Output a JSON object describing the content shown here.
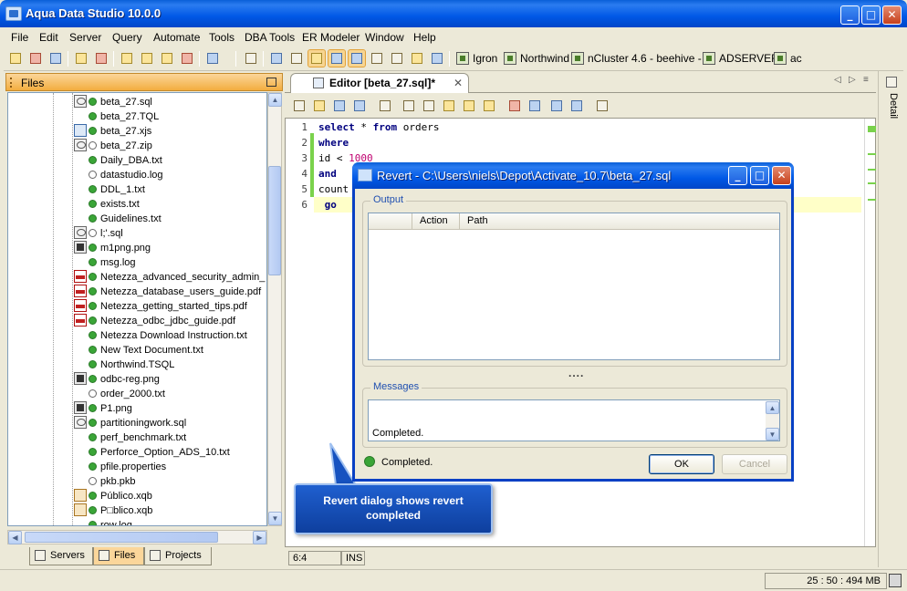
{
  "window": {
    "title": "Aqua Data Studio 10.0.0",
    "btn_min": "_",
    "btn_max": "□",
    "btn_close": "✕"
  },
  "menu": [
    "File",
    "Edit",
    "Server",
    "Query",
    "Automate",
    "Tools",
    "DBA Tools",
    "ER Modeler",
    "Window",
    "Help"
  ],
  "toolbar": {
    "servers": [
      "Igron",
      "Northwind",
      "nCluster 4.6 - beehive -",
      "ADSERVER",
      "ac"
    ]
  },
  "files_panel": {
    "title": "Files",
    "items": [
      {
        "name": "beta_27.sql",
        "icon": "sql-file-icon",
        "status": "ok"
      },
      {
        "name": "beta_27.TQL",
        "icon": "none",
        "status": "ok"
      },
      {
        "name": "beta_27.xjs",
        "icon": "xjs-file-icon",
        "status": "ok"
      },
      {
        "name": "beta_27.zip",
        "icon": "zip-file-icon",
        "status": "open"
      },
      {
        "name": "Daily_DBA.txt",
        "icon": "none",
        "status": "ok"
      },
      {
        "name": "datastudio.log",
        "icon": "none",
        "status": "open"
      },
      {
        "name": "DDL_1.txt",
        "icon": "none",
        "status": "ok"
      },
      {
        "name": "exists.txt",
        "icon": "none",
        "status": "ok"
      },
      {
        "name": "Guidelines.txt",
        "icon": "none",
        "status": "ok"
      },
      {
        "name": "l;'.sql",
        "icon": "sql-file-icon",
        "status": "open"
      },
      {
        "name": "m1png.png",
        "icon": "image-file-icon",
        "status": "ok"
      },
      {
        "name": "msg.log",
        "icon": "none",
        "status": "ok"
      },
      {
        "name": "Netezza_advanced_security_admin_",
        "icon": "pdf-file-icon",
        "status": "ok"
      },
      {
        "name": "Netezza_database_users_guide.pdf",
        "icon": "pdf-file-icon",
        "status": "ok"
      },
      {
        "name": "Netezza_getting_started_tips.pdf",
        "icon": "pdf-file-icon",
        "status": "ok"
      },
      {
        "name": "Netezza_odbc_jdbc_guide.pdf",
        "icon": "pdf-file-icon",
        "status": "ok"
      },
      {
        "name": "Netezza Download Instruction.txt",
        "icon": "none",
        "status": "ok"
      },
      {
        "name": "New Text Document.txt",
        "icon": "none",
        "status": "ok"
      },
      {
        "name": "Northwind.TSQL",
        "icon": "none",
        "status": "ok"
      },
      {
        "name": "odbc-reg.png",
        "icon": "image-file-icon",
        "status": "ok"
      },
      {
        "name": "order_2000.txt",
        "icon": "none",
        "status": "open"
      },
      {
        "name": "P1.png",
        "icon": "image-file-icon",
        "status": "ok"
      },
      {
        "name": "partitioningwork.sql",
        "icon": "sql-file-icon",
        "status": "ok"
      },
      {
        "name": "perf_benchmark.txt",
        "icon": "none",
        "status": "ok"
      },
      {
        "name": "Perforce_Option_ADS_10.txt",
        "icon": "none",
        "status": "ok"
      },
      {
        "name": "pfile.properties",
        "icon": "none",
        "status": "ok"
      },
      {
        "name": "pkb.pkb",
        "icon": "none",
        "status": "open"
      },
      {
        "name": "Público.xqb",
        "icon": "xqb-file-icon",
        "status": "ok"
      },
      {
        "name": "P□blico.xqb",
        "icon": "xqb-file-icon",
        "status": "ok"
      },
      {
        "name": "row.log",
        "icon": "none",
        "status": "ok"
      }
    ],
    "tabs": [
      "Servers",
      "Files",
      "Projects"
    ]
  },
  "editor": {
    "tab_title": "Editor [beta_27.sql]*",
    "tab_close": "✕",
    "lines": [
      {
        "n": "1",
        "tokens": [
          {
            "t": "select",
            "c": "kw"
          },
          {
            "t": " * ",
            "c": ""
          },
          {
            "t": "from",
            "c": "kw"
          },
          {
            "t": " orders",
            "c": ""
          }
        ]
      },
      {
        "n": "2",
        "tokens": [
          {
            "t": "where",
            "c": "kw"
          }
        ]
      },
      {
        "n": "3",
        "tokens": [
          {
            "t": "id < ",
            "c": ""
          },
          {
            "t": "1000",
            "c": "num"
          }
        ]
      },
      {
        "n": "4",
        "tokens": [
          {
            "t": "and",
            "c": "kw"
          }
        ]
      },
      {
        "n": "5",
        "tokens": [
          {
            "t": "count",
            "c": ""
          }
        ]
      },
      {
        "n": "6",
        "tokens": [
          {
            "t": " go",
            "c": "kw"
          }
        ]
      }
    ],
    "status": {
      "position": "6:4",
      "mode": "INS"
    }
  },
  "detail": {
    "label": "Detail"
  },
  "statusbar": {
    "memory": "25 : 50 : 494 MB"
  },
  "dialog": {
    "title": "Revert - C:\\Users\\niels\\Depot\\Activate_10.7\\beta_27.sql",
    "output_label": "Output",
    "columns": [
      "",
      "Action",
      "Path"
    ],
    "splitter": "....",
    "messages_label": "Messages",
    "message_text": "Completed.",
    "status_text": "Completed.",
    "ok_label": "OK",
    "cancel_label": "Cancel"
  },
  "callout": {
    "text": "Revert dialog shows revert completed"
  }
}
